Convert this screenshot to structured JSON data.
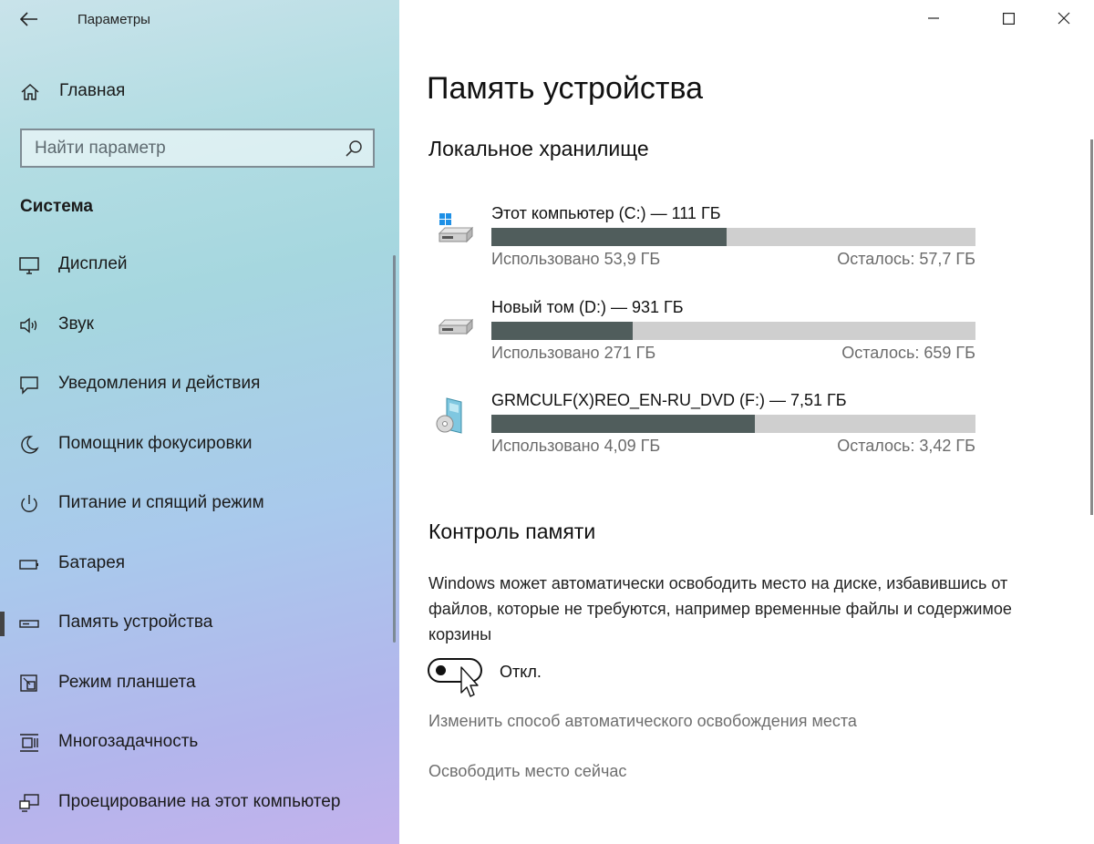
{
  "window": {
    "title": "Параметры"
  },
  "sidebar": {
    "home_label": "Главная",
    "search_placeholder": "Найти параметр",
    "section_title": "Система",
    "items": [
      {
        "label": "Дисплей",
        "icon": "display-icon"
      },
      {
        "label": "Звук",
        "icon": "sound-icon"
      },
      {
        "label": "Уведомления и действия",
        "icon": "notifications-icon"
      },
      {
        "label": "Помощник фокусировки",
        "icon": "moon-icon"
      },
      {
        "label": "Питание и спящий режим",
        "icon": "power-icon"
      },
      {
        "label": "Батарея",
        "icon": "battery-icon"
      },
      {
        "label": "Память устройства",
        "icon": "storage-icon",
        "active": true
      },
      {
        "label": "Режим планшета",
        "icon": "tablet-icon"
      },
      {
        "label": "Многозадачность",
        "icon": "multitasking-icon"
      },
      {
        "label": "Проецирование на этот компьютер",
        "icon": "projecting-icon"
      }
    ]
  },
  "main": {
    "page_title": "Память устройства",
    "local_storage_heading": "Локальное хранилище",
    "drives": [
      {
        "name": "Этот компьютер (C:) — 111 ГБ",
        "used": "Использовано 53,9 ГБ",
        "free": "Осталось: 57,7 ГБ",
        "used_fraction": 0.486,
        "icon": "system-drive-icon"
      },
      {
        "name": "Новый том (D:) — 931 ГБ",
        "used": "Использовано 271 ГБ",
        "free": "Осталось: 659 ГБ",
        "used_fraction": 0.291,
        "icon": "hard-drive-icon"
      },
      {
        "name": "GRMCULF(X)REO_EN-RU_DVD (F:) — 7,51 ГБ",
        "used": "Использовано 4,09 ГБ",
        "free": "Осталось: 3,42 ГБ",
        "used_fraction": 0.545,
        "icon": "dvd-drive-icon"
      }
    ],
    "storage_sense_heading": "Контроль памяти",
    "storage_sense_desc": "Windows может автоматически освободить место на диске, избавившись от файлов, которые не требуются, например временные файлы и содержимое корзины",
    "toggle_state": "Откл.",
    "toggle_on": false,
    "link_change": "Изменить способ автоматического освобождения места",
    "link_free_now": "Освободить место сейчас"
  },
  "colors": {
    "bar_fill": "#505d5c",
    "bar_track": "#cfcfcf",
    "link": "#6e6e6e"
  }
}
